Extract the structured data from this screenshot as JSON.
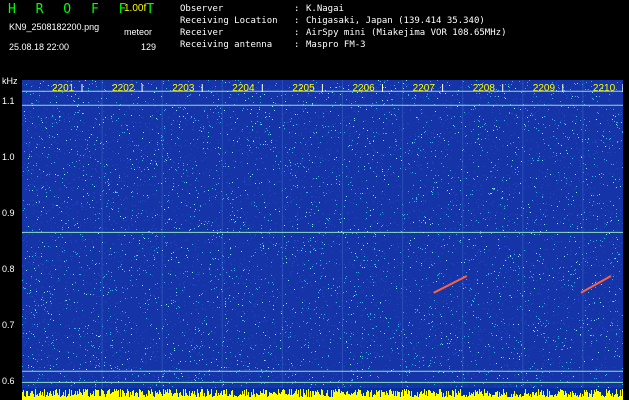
{
  "header": {
    "app_title": "H R O F F T",
    "version": "1.00f",
    "filename": "KN9_2508182200.png",
    "meteor_label": "meteor",
    "datetime": "25.08.18 22:00",
    "meteor_count": "129"
  },
  "info": [
    {
      "label": "Observer",
      "sep": ":",
      "value": "K.Nagai"
    },
    {
      "label": "Receiving Location",
      "sep": ":",
      "value": "Chigasaki, Japan (139.414 35.340)"
    },
    {
      "label": "Receiver",
      "sep": ":",
      "value": "AirSpy mini (Miakejima VOR 108.65MHz)"
    },
    {
      "label": "Receiving antenna",
      "sep": ":",
      "value": "Maspro FM-3"
    }
  ],
  "axis": {
    "y_unit": "kHz",
    "y_ticks": [
      "1.1",
      "1.0",
      "0.9",
      "0.8",
      "0.7",
      "0.6"
    ],
    "time_ticks": [
      "2201",
      "2202",
      "2203",
      "2204",
      "2205",
      "2206",
      "2207",
      "2208",
      "2209",
      "2210"
    ]
  },
  "colors": {
    "background": "#1434a8",
    "noise_low": "#2048c8",
    "noise_mid": "#30b0e0",
    "noise_high": "#80f0ff",
    "carrier": "#a0ffc0",
    "meteor": "#ff6040",
    "time_label": "#ffff00",
    "bottom_bar": "#ffff00"
  },
  "plot": {
    "y_range_khz": [
      0.59,
      1.14
    ],
    "carrier_lines_khz": [
      1.12,
      1.095,
      0.868,
      0.62,
      0.6
    ],
    "meteor_streaks": [
      {
        "minute": 6.85,
        "khz": 0.78,
        "length_min": 0.55
      },
      {
        "minute": 9.3,
        "khz": 0.78,
        "length_min": 0.5
      }
    ]
  }
}
